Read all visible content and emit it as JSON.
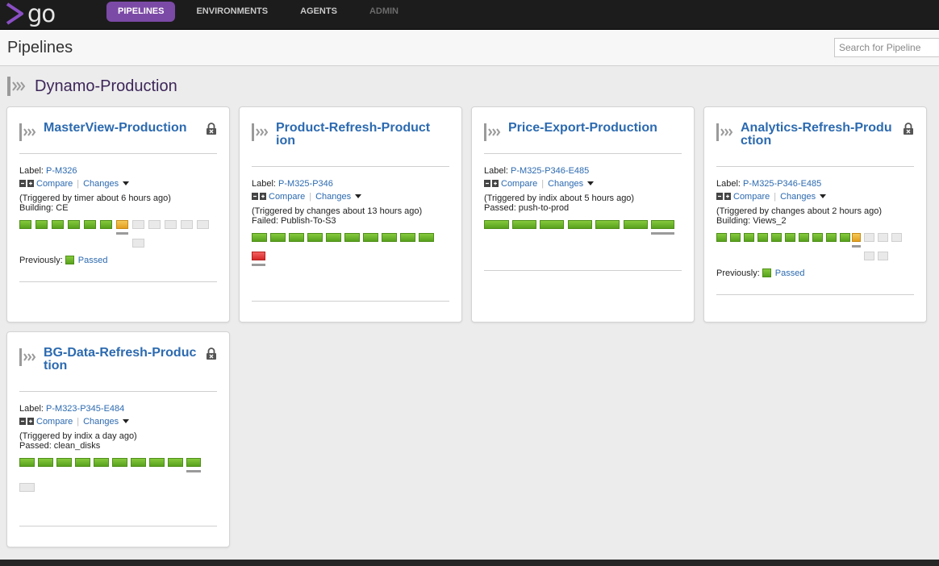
{
  "app": {
    "logo_text": "go"
  },
  "nav": {
    "items": [
      {
        "label": "PIPELINES",
        "state": "active"
      },
      {
        "label": "ENVIRONMENTS",
        "state": "normal"
      },
      {
        "label": "AGENTS",
        "state": "normal"
      },
      {
        "label": "ADMIN",
        "state": "disabled"
      }
    ]
  },
  "header": {
    "title": "Pipelines",
    "search_placeholder": "Search for Pipeline"
  },
  "group": {
    "name": "Dynamo-Production"
  },
  "colors": {
    "accent": "#7b4aa6",
    "link": "#2c6ab0",
    "passed": "#6ab52c",
    "building": "#eeb43a",
    "failed": "#e23b3b",
    "unknown": "#e9e9e9"
  },
  "common": {
    "label_prefix": "Label: ",
    "compare": "Compare",
    "changes": "Changes",
    "previously": "Previously:"
  },
  "pipelines": [
    {
      "name": "MasterView-Production",
      "locked": true,
      "label": "P-M326",
      "trigger": "(Triggered by timer about 6 hours ago)",
      "status": "Building: CE",
      "stages": [
        "passed",
        "passed",
        "passed",
        "passed",
        "passed",
        "passed",
        "building",
        "unknown",
        "unknown",
        "unknown",
        "unknown",
        "unknown",
        "unknown"
      ],
      "previous": "Passed"
    },
    {
      "name": "Product-Refresh-Production",
      "locked": false,
      "label": "P-M325-P346",
      "trigger": "(Triggered by changes about 13 hours ago)",
      "status": "Failed: Publish-To-S3",
      "stages": [
        "passed",
        "passed",
        "passed",
        "passed",
        "passed",
        "passed",
        "passed",
        "passed",
        "passed",
        "passed",
        "failed"
      ],
      "previous": ""
    },
    {
      "name": "Price-Export-Production",
      "locked": false,
      "label": "P-M325-P346-E485",
      "trigger": "(Triggered by indix about 5 hours ago)",
      "status": "Passed: push-to-prod",
      "stages": [
        "passed",
        "passed",
        "passed",
        "passed",
        "passed",
        "passed",
        "passed"
      ],
      "previous": ""
    },
    {
      "name": "Analytics-Refresh-Production",
      "locked": true,
      "label": "P-M325-P346-E485",
      "trigger": "(Triggered by changes about 2 hours ago)",
      "status": "Building: Views_2",
      "stages": [
        "passed",
        "passed",
        "passed",
        "passed",
        "passed",
        "passed",
        "passed",
        "passed",
        "passed",
        "passed",
        "building",
        "unknown",
        "unknown",
        "unknown",
        "unknown",
        "unknown"
      ],
      "previous": "Passed"
    },
    {
      "name": "BG-Data-Refresh-Production",
      "locked": true,
      "label": "P-M323-P345-E484",
      "trigger": "(Triggered by indix a day ago)",
      "status": "Passed: clean_disks",
      "stages": [
        "passed",
        "passed",
        "passed",
        "passed",
        "passed",
        "passed",
        "passed",
        "passed",
        "passed",
        "passed",
        "unknown"
      ],
      "previous": ""
    }
  ]
}
